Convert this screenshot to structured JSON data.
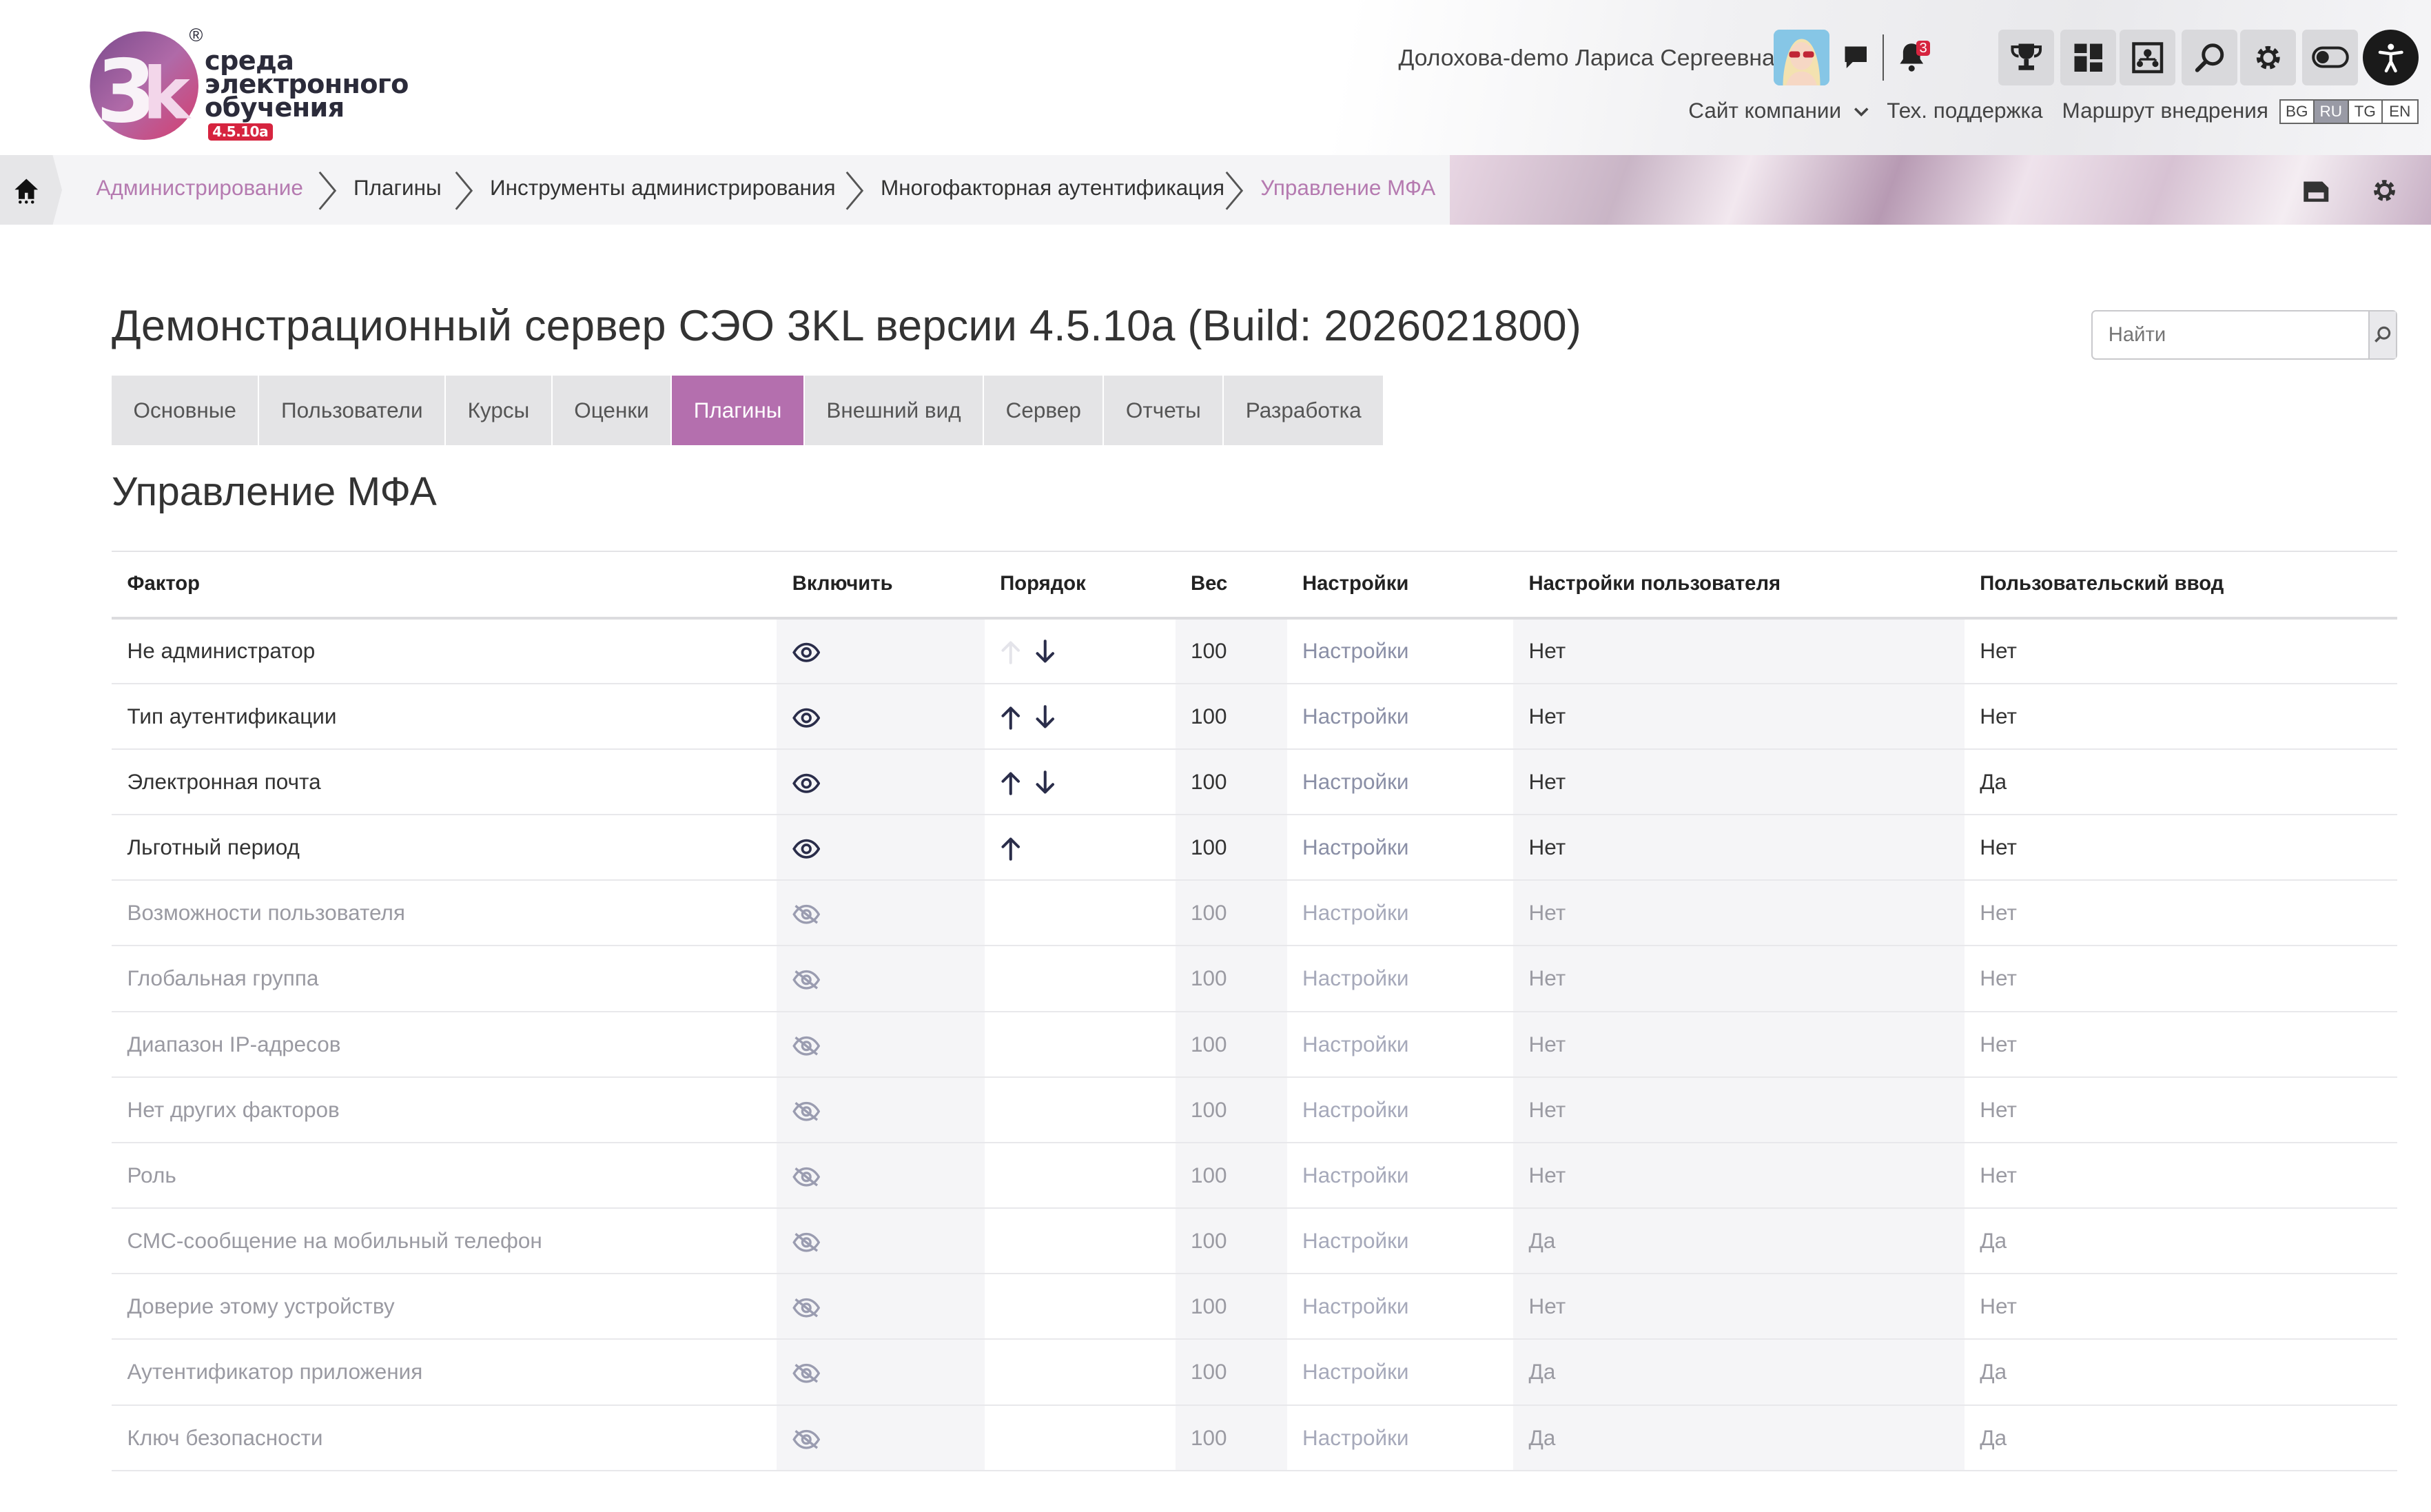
{
  "brand": {
    "logo_line1": "среда",
    "logo_line2": "электронного",
    "logo_line3": "обучения",
    "version_badge": "4.5.10a",
    "registered": "®",
    "colors": {
      "accent": "#b46fae",
      "badge": "#d6243f"
    }
  },
  "header": {
    "user_name": "Долохова-demo Лариса Сергеевна",
    "notifications_count": "3",
    "links": {
      "company_site": "Сайт компании",
      "support": "Тех. поддержка",
      "roadmap": "Маршрут внедрения"
    },
    "languages": [
      "BG",
      "RU",
      "TG",
      "EN"
    ],
    "active_language": "RU",
    "tool_icons": [
      "trophy-icon",
      "dashboard-icon",
      "org-chart-icon",
      "search-icon",
      "gear-icon",
      "toggle-icon",
      "accessibility-icon"
    ]
  },
  "breadcrumb": {
    "items": [
      "Администрирование",
      "Плагины",
      "Инструменты администрирования",
      "Многофакторная аутентификация",
      "Управление МФА"
    ]
  },
  "page": {
    "title": "Демонстрационный сервер СЭО 3KL версии 4.5.10a (Build: 2026021800)",
    "search_placeholder": "Найти",
    "section_title": "Управление МФА"
  },
  "tabs": [
    {
      "label": "Основные",
      "active": false
    },
    {
      "label": "Пользователи",
      "active": false
    },
    {
      "label": "Курсы",
      "active": false
    },
    {
      "label": "Оценки",
      "active": false
    },
    {
      "label": "Плагины",
      "active": true
    },
    {
      "label": "Внешний вид",
      "active": false
    },
    {
      "label": "Сервер",
      "active": false
    },
    {
      "label": "Отчеты",
      "active": false
    },
    {
      "label": "Разработка",
      "active": false
    }
  ],
  "table": {
    "headers": {
      "factor": "Фактор",
      "enable": "Включить",
      "order": "Порядок",
      "weight": "Вес",
      "settings": "Настройки",
      "user_settings": "Настройки пользователя",
      "user_input": "Пользовательский ввод"
    },
    "rows": [
      {
        "factor": "Не администратор",
        "enabled": true,
        "up": false,
        "down": true,
        "weight": "100",
        "settings": "Настройки",
        "user_settings": "Нет",
        "user_input": "Нет"
      },
      {
        "factor": "Тип аутентификации",
        "enabled": true,
        "up": true,
        "down": true,
        "weight": "100",
        "settings": "Настройки",
        "user_settings": "Нет",
        "user_input": "Нет"
      },
      {
        "factor": "Электронная почта",
        "enabled": true,
        "up": true,
        "down": true,
        "weight": "100",
        "settings": "Настройки",
        "user_settings": "Нет",
        "user_input": "Да"
      },
      {
        "factor": "Льготный период",
        "enabled": true,
        "up": true,
        "down": false,
        "weight": "100",
        "settings": "Настройки",
        "user_settings": "Нет",
        "user_input": "Нет"
      },
      {
        "factor": "Возможности пользователя",
        "enabled": false,
        "up": false,
        "down": false,
        "weight": "100",
        "settings": "Настройки",
        "user_settings": "Нет",
        "user_input": "Нет"
      },
      {
        "factor": "Глобальная группа",
        "enabled": false,
        "up": false,
        "down": false,
        "weight": "100",
        "settings": "Настройки",
        "user_settings": "Нет",
        "user_input": "Нет"
      },
      {
        "factor": "Диапазон IP-адресов",
        "enabled": false,
        "up": false,
        "down": false,
        "weight": "100",
        "settings": "Настройки",
        "user_settings": "Нет",
        "user_input": "Нет"
      },
      {
        "factor": "Нет других факторов",
        "enabled": false,
        "up": false,
        "down": false,
        "weight": "100",
        "settings": "Настройки",
        "user_settings": "Нет",
        "user_input": "Нет"
      },
      {
        "factor": "Роль",
        "enabled": false,
        "up": false,
        "down": false,
        "weight": "100",
        "settings": "Настройки",
        "user_settings": "Нет",
        "user_input": "Нет"
      },
      {
        "factor": "СМС-сообщение на мобильный телефон",
        "enabled": false,
        "up": false,
        "down": false,
        "weight": "100",
        "settings": "Настройки",
        "user_settings": "Да",
        "user_input": "Да"
      },
      {
        "factor": "Доверие этому устройству",
        "enabled": false,
        "up": false,
        "down": false,
        "weight": "100",
        "settings": "Настройки",
        "user_settings": "Нет",
        "user_input": "Нет"
      },
      {
        "factor": "Аутентификатор приложения",
        "enabled": false,
        "up": false,
        "down": false,
        "weight": "100",
        "settings": "Настройки",
        "user_settings": "Да",
        "user_input": "Да"
      },
      {
        "factor": "Ключ безопасности",
        "enabled": false,
        "up": false,
        "down": false,
        "weight": "100",
        "settings": "Настройки",
        "user_settings": "Да",
        "user_input": "Да"
      }
    ]
  }
}
